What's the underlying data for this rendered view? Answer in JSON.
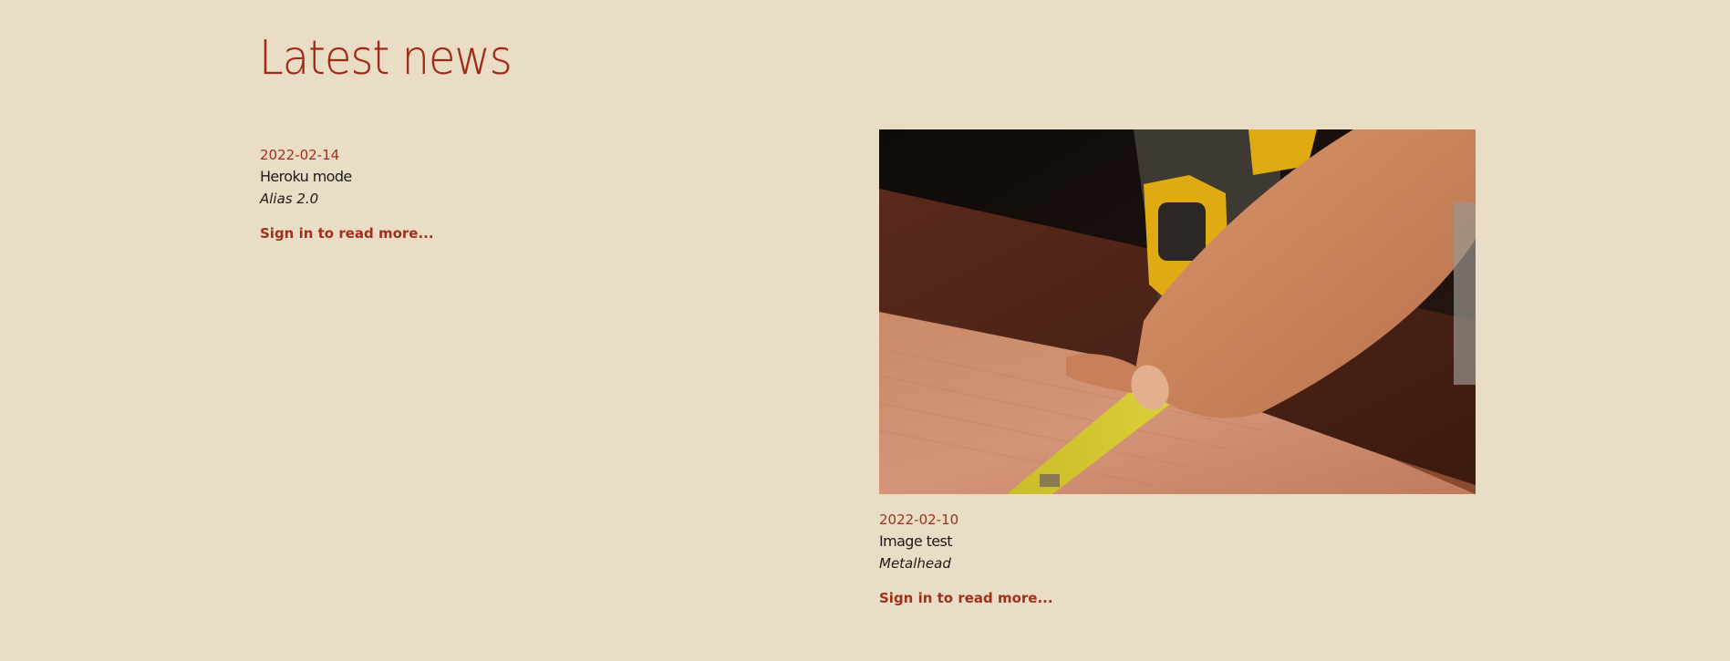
{
  "page": {
    "title": "Latest news"
  },
  "articles": [
    {
      "date": "2022-02-14",
      "title": "Heroku mode",
      "author": "Alias 2.0",
      "link_label": "Sign in to read more..."
    },
    {
      "date": "2022-02-10",
      "title": "Image test",
      "author": "Metalhead",
      "link_label": "Sign in to read more...",
      "image_alt": "hand-measuring-wood-with-tape-measure"
    }
  ],
  "colors": {
    "background": "#e9ddc6",
    "accent": "#a0301c",
    "text": "#1e1a14"
  }
}
